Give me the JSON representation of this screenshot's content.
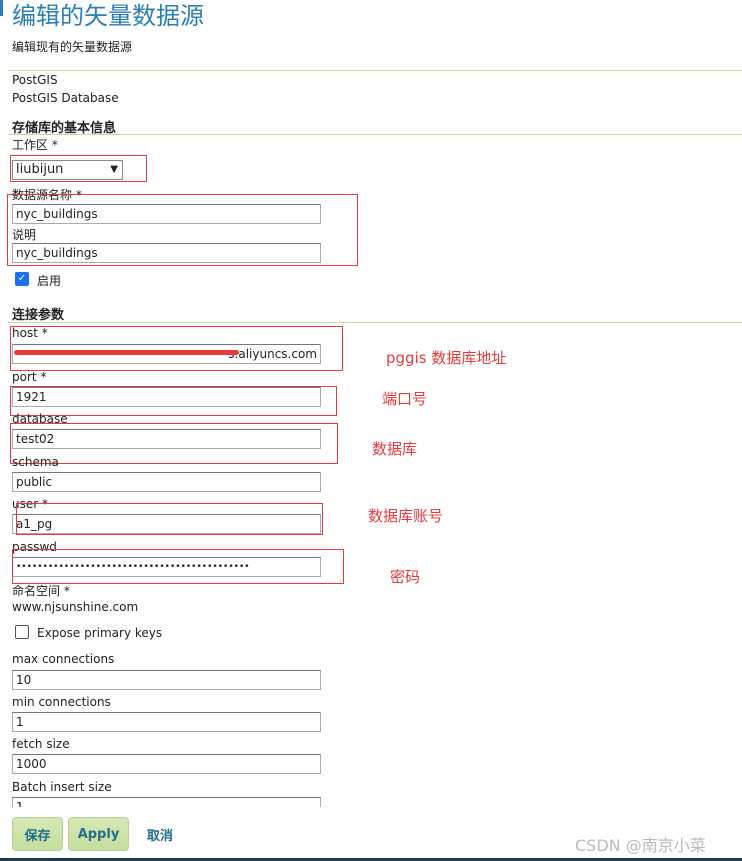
{
  "header": {
    "title": "编辑的矢量数据源",
    "subtitle": "编辑现有的矢量数据源"
  },
  "store_type": {
    "name": "PostGIS",
    "description": "PostGIS Database"
  },
  "basic": {
    "heading": "存储库的基本信息",
    "workspace_label": "工作区 *",
    "workspace_value": "liubijun",
    "name_label": "数据源名称 *",
    "name_value": "nyc_buildings",
    "desc_label": "说明",
    "desc_value": "nyc_buildings",
    "enabled_label": "启用",
    "enabled": true
  },
  "connection": {
    "heading": "连接参数",
    "host_label": "host *",
    "host_value": "s.aliyuncs.com",
    "port_label": "port *",
    "port_value": "1921",
    "database_label": "database",
    "database_value": "test02",
    "schema_label": "schema",
    "schema_value": "public",
    "user_label": "user *",
    "user_value": "a1_pg",
    "passwd_label": "passwd",
    "passwd_value": "••••••••••••••••••••••••••••••••••••••••••••",
    "namespace_label": "命名空间 *",
    "namespace_value": "www.njsunshine.com",
    "expose_label": "Expose primary keys",
    "expose": false,
    "maxconn_label": "max connections",
    "maxconn_value": "10",
    "minconn_label": "min connections",
    "minconn_value": "1",
    "fetch_label": "fetch size",
    "fetch_value": "1000",
    "batch_label": "Batch insert size",
    "batch_value": "1"
  },
  "annotations": {
    "host": "pggis 数据库地址",
    "port": "端口号",
    "database": "数据库",
    "user": "数据库账号",
    "passwd": "密码"
  },
  "buttons": {
    "save": "保存",
    "apply": "Apply",
    "cancel": "取消"
  },
  "watermark": "CSDN @南京小菜",
  "colors": {
    "title": "#2a7fb5",
    "annotation": "#e83a3a",
    "button": "#c4df9e"
  }
}
